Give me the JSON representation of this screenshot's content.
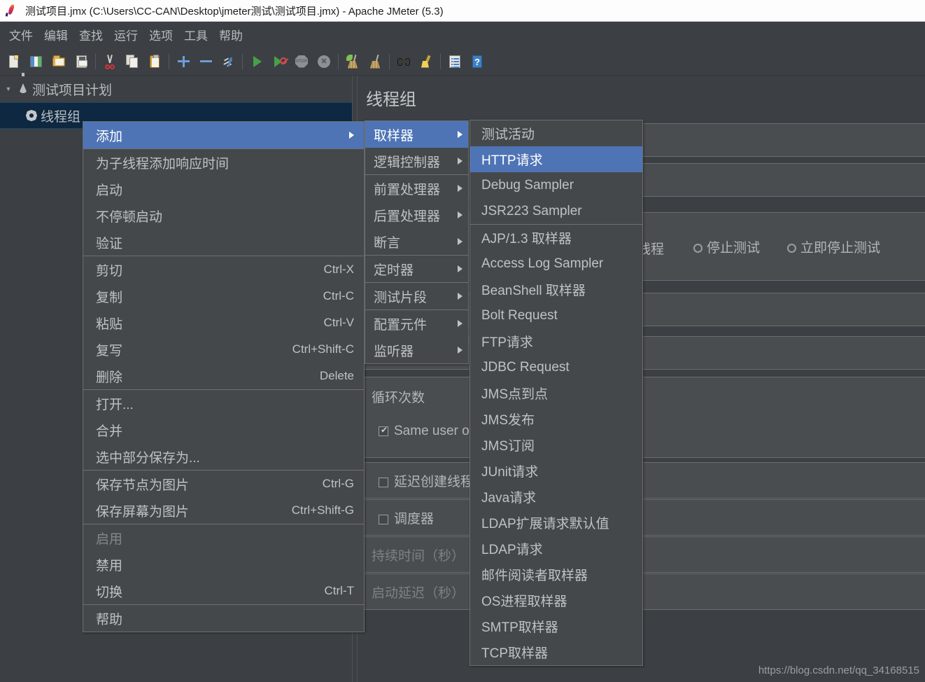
{
  "window": {
    "title": "测试项目.jmx (C:\\Users\\CC-CAN\\Desktop\\jmeter测试\\测试项目.jmx) - Apache JMeter (5.3)",
    "app_icon": "jmeter-feather-icon"
  },
  "menubar": {
    "items": [
      {
        "label": "文件"
      },
      {
        "label": "编辑"
      },
      {
        "label": "查找"
      },
      {
        "label": "运行"
      },
      {
        "label": "选项"
      },
      {
        "label": "工具"
      },
      {
        "label": "帮助"
      }
    ]
  },
  "toolbar": {
    "buttons": [
      {
        "icon": "new-file-icon"
      },
      {
        "icon": "templates-icon"
      },
      {
        "icon": "open-folder-icon"
      },
      {
        "icon": "save-icon"
      },
      {
        "sep": true
      },
      {
        "icon": "cut-scissors-icon"
      },
      {
        "icon": "copy-icon"
      },
      {
        "icon": "paste-clipboard-icon"
      },
      {
        "sep": true
      },
      {
        "icon": "expand-plus-icon"
      },
      {
        "icon": "collapse-minus-icon"
      },
      {
        "icon": "toggle-bolt-icon"
      },
      {
        "sep": true
      },
      {
        "icon": "start-play-icon"
      },
      {
        "icon": "start-no-pauses-icon"
      },
      {
        "icon": "stop-icon"
      },
      {
        "icon": "shutdown-icon"
      },
      {
        "sep": true
      },
      {
        "icon": "clear-broom-icon"
      },
      {
        "icon": "clear-all-broom-icon"
      },
      {
        "sep": true
      },
      {
        "icon": "search-binoculars-icon"
      },
      {
        "icon": "reset-search-brush-icon"
      },
      {
        "sep": true
      },
      {
        "icon": "function-helper-icon"
      },
      {
        "icon": "help-icon"
      }
    ]
  },
  "tree": {
    "root": {
      "label": "测试项目计划",
      "icon": "test-plan-flask-icon",
      "twisty": "expanded"
    },
    "child": {
      "label": "线程组",
      "icon": "thread-group-gear-icon",
      "selected": true
    }
  },
  "main": {
    "title": "线程组",
    "action_row": {
      "suffix_label": "线程",
      "options": [
        {
          "label": "停止测试",
          "selected": false
        },
        {
          "label": "立即停止测试",
          "selected": false
        }
      ]
    },
    "fields": [
      {
        "label": "循环次数"
      },
      {
        "label": "Same user on each iteration",
        "type": "checkbox",
        "checked": true
      },
      {
        "label": "延迟创建线程直到需要",
        "type": "checkbox",
        "checked": false
      },
      {
        "label": "调度器",
        "type": "checkbox",
        "checked": false
      },
      {
        "label": "持续时间（秒）",
        "dim": true
      },
      {
        "label": "启动延迟（秒）",
        "dim": true
      }
    ],
    "watermark": "https://blog.csdn.net/qq_34168515"
  },
  "context_menu": {
    "groups": [
      [
        {
          "label": "添加",
          "submenu": true,
          "highlighted": true
        }
      ],
      [
        {
          "label": "为子线程添加响应时间"
        },
        {
          "label": "启动"
        },
        {
          "label": "不停顿启动"
        },
        {
          "label": "验证"
        }
      ],
      [
        {
          "label": "剪切",
          "accel": "Ctrl-X"
        },
        {
          "label": "复制",
          "accel": "Ctrl-C"
        },
        {
          "label": "粘贴",
          "accel": "Ctrl-V"
        },
        {
          "label": "复写",
          "accel": "Ctrl+Shift-C"
        },
        {
          "label": "删除",
          "accel": "Delete"
        }
      ],
      [
        {
          "label": "打开..."
        },
        {
          "label": "合并"
        },
        {
          "label": "选中部分保存为..."
        }
      ],
      [
        {
          "label": "保存节点为图片",
          "accel": "Ctrl-G"
        },
        {
          "label": "保存屏幕为图片",
          "accel": "Ctrl+Shift-G"
        }
      ],
      [
        {
          "label": "启用",
          "disabled": true
        },
        {
          "label": "禁用"
        },
        {
          "label": "切换",
          "accel": "Ctrl-T"
        }
      ],
      [
        {
          "label": "帮助"
        }
      ]
    ]
  },
  "add_submenu": {
    "groups": [
      [
        {
          "label": "取样器",
          "submenu": true,
          "highlighted": true
        },
        {
          "label": "逻辑控制器",
          "submenu": true
        }
      ],
      [
        {
          "label": "前置处理器",
          "submenu": true
        },
        {
          "label": "后置处理器",
          "submenu": true
        },
        {
          "label": "断言",
          "submenu": true
        }
      ],
      [
        {
          "label": "定时器",
          "submenu": true
        }
      ],
      [
        {
          "label": "测试片段",
          "submenu": true
        }
      ],
      [
        {
          "label": "配置元件",
          "submenu": true
        },
        {
          "label": "监听器",
          "submenu": true
        }
      ]
    ]
  },
  "sampler_menu": {
    "groups": [
      [
        {
          "label": "测试活动"
        },
        {
          "label": "HTTP请求",
          "highlighted": true
        },
        {
          "label": "Debug Sampler"
        },
        {
          "label": "JSR223 Sampler"
        }
      ],
      [
        {
          "label": "AJP/1.3 取样器"
        },
        {
          "label": "Access Log Sampler"
        },
        {
          "label": "BeanShell 取样器"
        },
        {
          "label": "Bolt Request"
        },
        {
          "label": "FTP请求"
        },
        {
          "label": "JDBC Request"
        },
        {
          "label": "JMS点到点"
        },
        {
          "label": "JMS发布"
        },
        {
          "label": "JMS订阅"
        },
        {
          "label": "JUnit请求"
        },
        {
          "label": "Java请求"
        },
        {
          "label": "LDAP扩展请求默认值"
        },
        {
          "label": "LDAP请求"
        },
        {
          "label": "邮件阅读者取样器"
        },
        {
          "label": "OS进程取样器"
        },
        {
          "label": "SMTP取样器"
        },
        {
          "label": "TCP取样器"
        }
      ]
    ]
  },
  "colors": {
    "titlebar_bg": "#fdfdfd",
    "app_bg": "#3c4044",
    "panel_row_bg": "#4a4d4f",
    "menu_bg": "#45484b",
    "menu_border": "#6d7073",
    "highlight_blue": "#4e74b5",
    "tree_selection": "#0d2840",
    "text_primary": "#bfc2c4",
    "text_dim": "#84878a"
  }
}
